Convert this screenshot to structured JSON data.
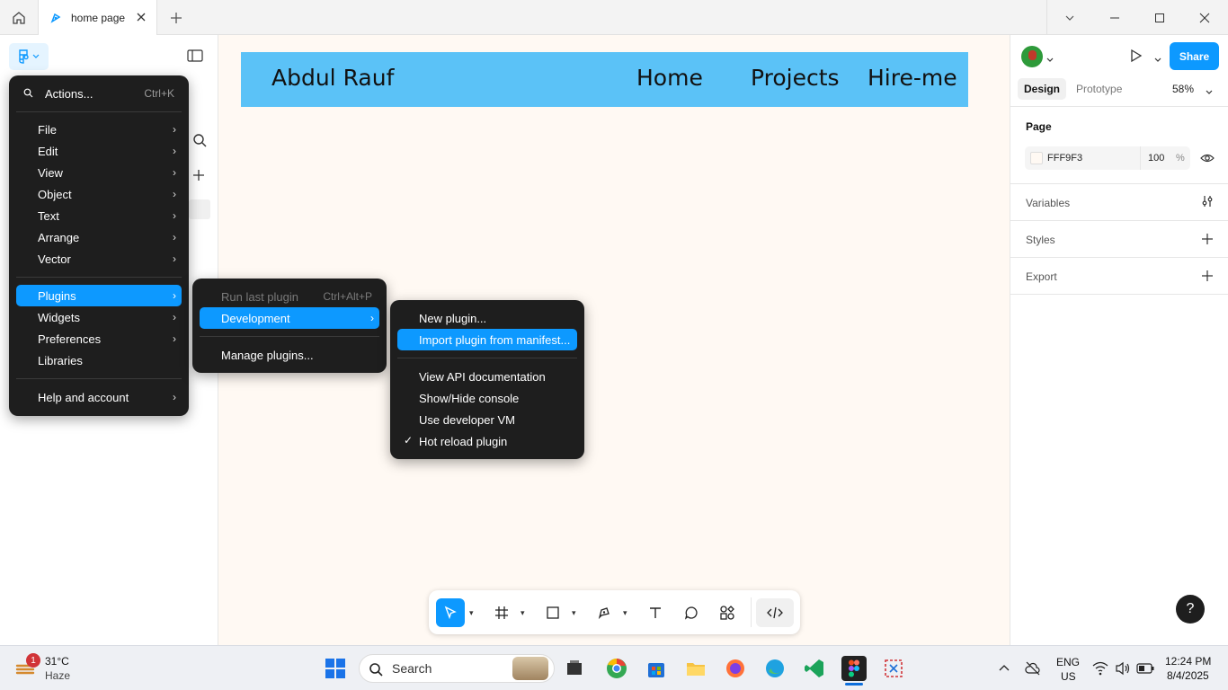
{
  "browser": {
    "tab_title": "home page"
  },
  "canvas": {
    "frame": {
      "name_text": "Abdul Rauf",
      "nav_links": [
        "Home",
        "Projects",
        "Hire-me"
      ],
      "bg_color": "#5bc2f7"
    },
    "bg_color": "#fff9f3"
  },
  "main_menu": {
    "actions_label": "Actions...",
    "actions_shortcut": "Ctrl+K",
    "items": [
      "File",
      "Edit",
      "View",
      "Object",
      "Text",
      "Arrange",
      "Vector"
    ],
    "items2": [
      "Plugins",
      "Widgets",
      "Preferences",
      "Libraries"
    ],
    "help": "Help and account"
  },
  "plugins_menu": {
    "run_last": "Run last plugin",
    "run_last_shortcut": "Ctrl+Alt+P",
    "development": "Development",
    "manage": "Manage plugins..."
  },
  "dev_menu": {
    "new_plugin": "New plugin...",
    "import_manifest": "Import plugin from manifest...",
    "view_api": "View API documentation",
    "console": "Show/Hide console",
    "dev_vm": "Use developer VM",
    "hot_reload": "Hot reload plugin",
    "hot_reload_check": "✓"
  },
  "right_panel": {
    "tab_design": "Design",
    "tab_prototype": "Prototype",
    "zoom": "58%",
    "share": "Share",
    "page_label": "Page",
    "page_color": "FFF9F3",
    "page_opacity": "100",
    "percent": "%",
    "variables": "Variables",
    "styles": "Styles",
    "export": "Export"
  },
  "help_label": "?",
  "taskbar": {
    "weather_temp": "31°C",
    "weather_desc": "Haze",
    "weather_badge": "1",
    "search_label": "Search",
    "lang": "ENG",
    "region": "US",
    "time": "12:24 PM",
    "date": "8/4/2025"
  },
  "colors": {
    "accent": "#0d99ff",
    "menu_bg": "#1e1e1e"
  }
}
